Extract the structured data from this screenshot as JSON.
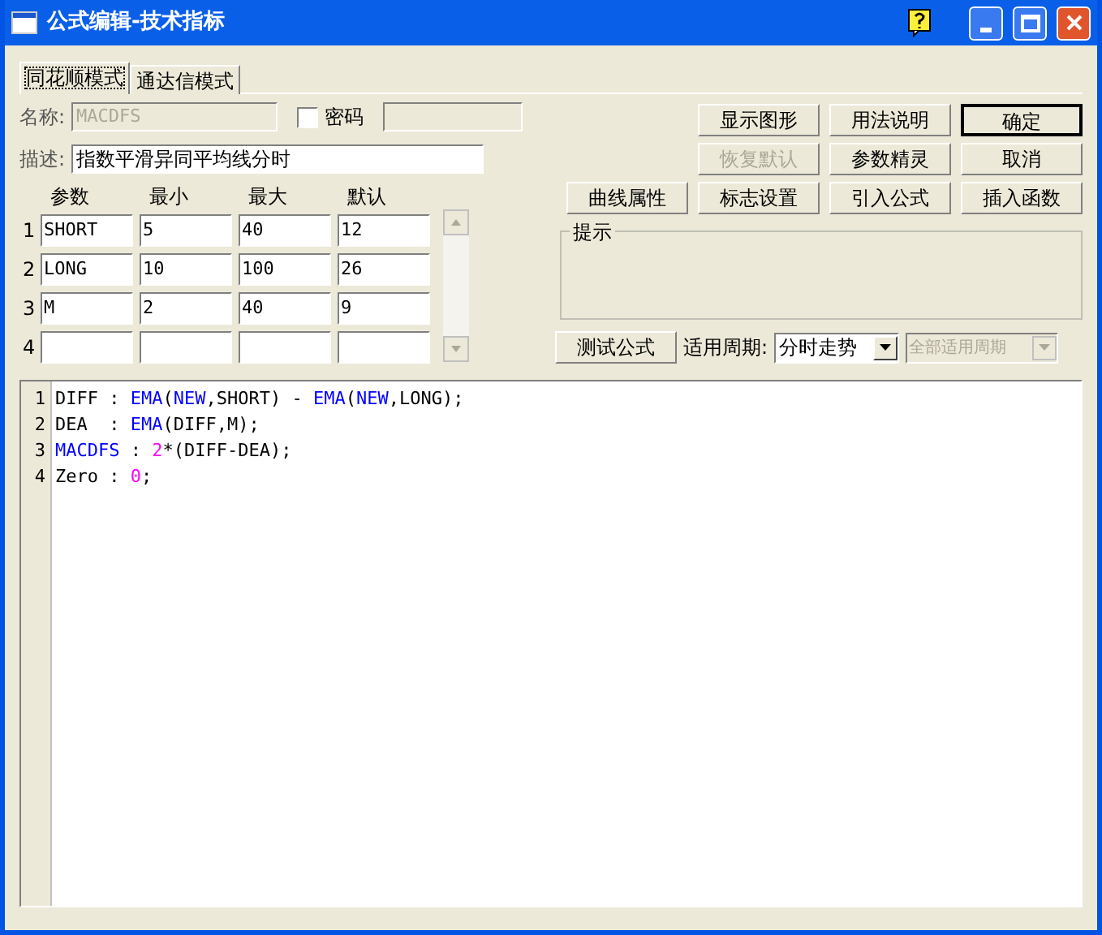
{
  "window": {
    "title": "公式编辑-技术指标"
  },
  "tabs": [
    {
      "label": "同花顺模式",
      "selected": true
    },
    {
      "label": "通达信模式",
      "selected": false
    }
  ],
  "name_field": {
    "label": "名称:",
    "value": "MACDFS",
    "disabled": true
  },
  "password": {
    "label": "密码",
    "checked": false
  },
  "description": {
    "label": "描述:",
    "value": "指数平滑异同平均线分时"
  },
  "params": {
    "columns": [
      "参数",
      "最小",
      "最大",
      "默认"
    ],
    "rows": [
      {
        "index": "1",
        "cells": [
          "SHORT",
          "5",
          "40",
          "12"
        ]
      },
      {
        "index": "2",
        "cells": [
          "LONG",
          "10",
          "100",
          "26"
        ]
      },
      {
        "index": "3",
        "cells": [
          "M",
          "2",
          "40",
          "9"
        ]
      },
      {
        "index": "4",
        "cells": [
          "",
          "",
          "",
          ""
        ]
      }
    ]
  },
  "button_rows": [
    [
      {
        "label": "显示图形",
        "disabled": false,
        "default": false
      },
      {
        "label": "用法说明",
        "disabled": false,
        "default": false
      },
      {
        "label": "确定",
        "disabled": false,
        "default": true
      }
    ],
    [
      {
        "label": "恢复默认",
        "disabled": true,
        "default": false
      },
      {
        "label": "参数精灵",
        "disabled": false,
        "default": false
      },
      {
        "label": "取消",
        "disabled": false,
        "default": false
      }
    ],
    [
      {
        "label": "曲线属性",
        "disabled": false,
        "default": false
      },
      {
        "label": "标志设置",
        "disabled": false,
        "default": false
      },
      {
        "label": "引入公式",
        "disabled": false,
        "default": false
      },
      {
        "label": "插入函数",
        "disabled": false,
        "default": false
      }
    ]
  ],
  "hint": {
    "title": "提示"
  },
  "test_button": {
    "label": "测试公式"
  },
  "period": {
    "label": "适用周期:",
    "value": "分时走势",
    "disabled": false
  },
  "all_periods": {
    "value": "全部适用周期",
    "disabled": true
  },
  "code": [
    {
      "number": "1",
      "tokens": [
        {
          "text": "DIFF : ",
          "kind": "plain"
        },
        {
          "text": "EMA",
          "kind": "func"
        },
        {
          "text": "(",
          "kind": "plain"
        },
        {
          "text": "NEW",
          "kind": "func"
        },
        {
          "text": ",SHORT) - ",
          "kind": "plain"
        },
        {
          "text": "EMA",
          "kind": "func"
        },
        {
          "text": "(",
          "kind": "plain"
        },
        {
          "text": "NEW",
          "kind": "func"
        },
        {
          "text": ",LONG);",
          "kind": "plain"
        }
      ]
    },
    {
      "number": "2",
      "tokens": [
        {
          "text": "DEA  : ",
          "kind": "plain"
        },
        {
          "text": "EMA",
          "kind": "func"
        },
        {
          "text": "(DIFF,M);",
          "kind": "plain"
        }
      ]
    },
    {
      "number": "3",
      "tokens": [
        {
          "text": "MACDFS",
          "kind": "func"
        },
        {
          "text": " : ",
          "kind": "plain"
        },
        {
          "text": "2",
          "kind": "num"
        },
        {
          "text": "*(DIFF-DEA);",
          "kind": "plain"
        }
      ]
    },
    {
      "number": "4",
      "tokens": [
        {
          "text": "Zero : ",
          "kind": "plain"
        },
        {
          "text": "0",
          "kind": "num"
        },
        {
          "text": ";",
          "kind": "plain"
        }
      ]
    }
  ]
}
